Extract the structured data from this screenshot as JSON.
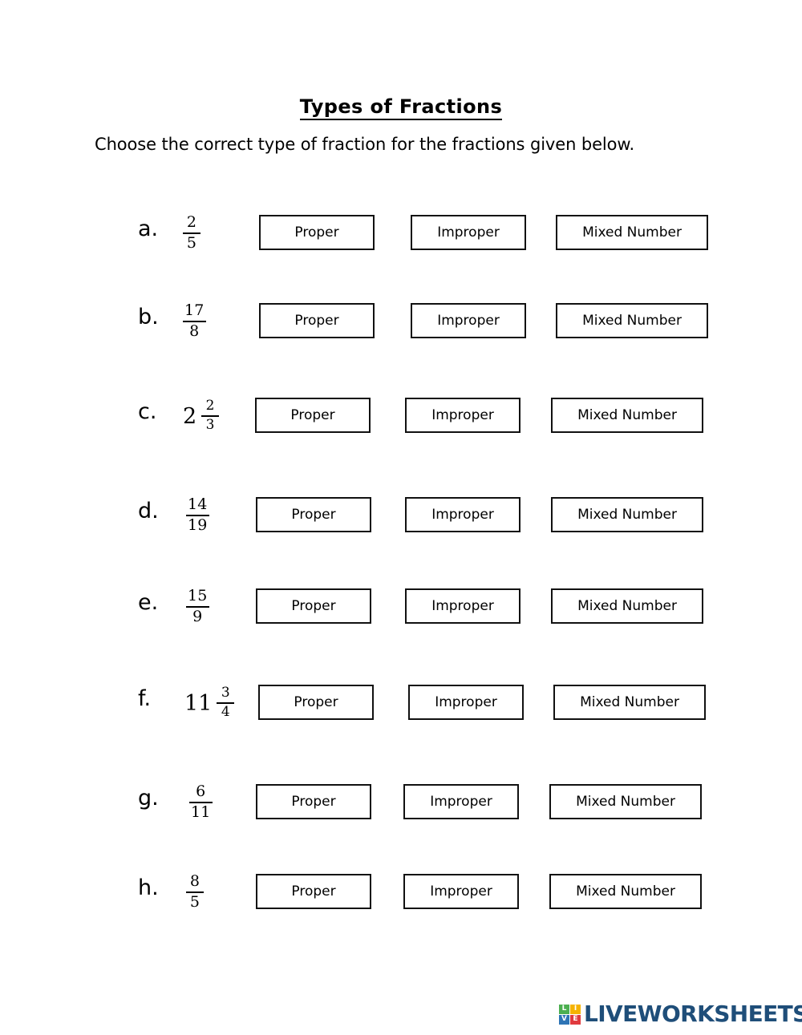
{
  "worksheet": {
    "title": "Types of Fractions",
    "instruction": "Choose the correct type of fraction for the fractions given below.",
    "option_labels": {
      "proper": "Proper",
      "improper": "Improper",
      "mixed_number": "Mixed Number"
    },
    "questions": [
      {
        "label": "a.",
        "kind": "fraction",
        "whole": "",
        "numerator": "2",
        "denominator": "5",
        "options": [
          "Proper",
          "Improper",
          "Mixed Number"
        ]
      },
      {
        "label": "b.",
        "kind": "fraction",
        "whole": "",
        "numerator": "17",
        "denominator": "8",
        "options": [
          "Proper",
          "Improper",
          "Mixed Number"
        ]
      },
      {
        "label": "c.",
        "kind": "mixed",
        "whole": "2",
        "numerator": "2",
        "denominator": "3",
        "options": [
          "Proper",
          "Improper",
          "Mixed Number"
        ]
      },
      {
        "label": "d.",
        "kind": "fraction",
        "whole": "",
        "numerator": "14",
        "denominator": "19",
        "options": [
          "Proper",
          "Improper",
          "Mixed Number"
        ]
      },
      {
        "label": "e.",
        "kind": "fraction",
        "whole": "",
        "numerator": "15",
        "denominator": "9",
        "options": [
          "Proper",
          "Improper",
          "Mixed Number"
        ]
      },
      {
        "label": "f.",
        "kind": "mixed",
        "whole": "11",
        "numerator": "3",
        "denominator": "4",
        "options": [
          "Proper",
          "Improper",
          "Mixed Number"
        ]
      },
      {
        "label": "g.",
        "kind": "fraction",
        "whole": "",
        "numerator": "6",
        "denominator": "11",
        "options": [
          "Proper",
          "Improper",
          "Mixed Number"
        ]
      },
      {
        "label": "h.",
        "kind": "fraction",
        "whole": "",
        "numerator": "8",
        "denominator": "5",
        "options": [
          "Proper",
          "Improper",
          "Mixed Number"
        ]
      }
    ]
  },
  "footer": {
    "logo_tiles": [
      "L",
      "I",
      "V",
      "E"
    ],
    "wordmark": "LIVEWORKSHEETS",
    "brand_color": "#1F4E79",
    "tile_colors": [
      "#4CAF50",
      "#F5B301",
      "#2E74B5",
      "#E03A3E"
    ]
  },
  "layout": {
    "row_tops": [
      0,
      110,
      228,
      352,
      466,
      586,
      710,
      822
    ],
    "option_lefts": [
      [
        323,
        512,
        693
      ],
      [
        323,
        512,
        693
      ],
      [
        318,
        505,
        687
      ],
      [
        319,
        505,
        687
      ],
      [
        319,
        505,
        687
      ],
      [
        322,
        509,
        690
      ],
      [
        319,
        503,
        685
      ],
      [
        319,
        503,
        685
      ]
    ],
    "label_lefts": [
      172,
      172,
      172,
      172,
      172,
      172,
      172,
      172
    ],
    "expr_lefts": [
      228,
      228,
      228,
      232,
      232,
      230,
      236,
      232
    ]
  }
}
